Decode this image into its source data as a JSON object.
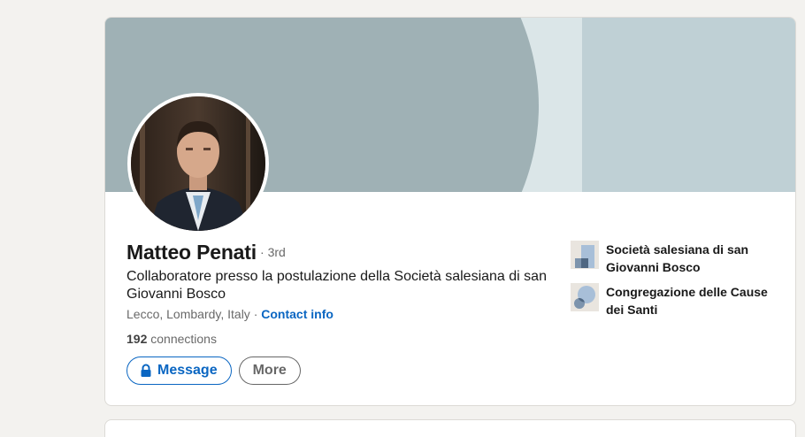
{
  "profile": {
    "name": "Matteo Penati",
    "degree": "3rd",
    "degree_separator": "·",
    "headline": "Collaboratore presso la postulazione della Società salesiana di san Giovanni Bosco",
    "location": "Lecco, Lombardy, Italy",
    "location_separator": " · ",
    "contact_info_label": "Contact info",
    "connections_count": "192",
    "connections_label": "connections"
  },
  "actions": {
    "message_label": "Message",
    "more_label": "More"
  },
  "organizations": [
    {
      "name": "Società salesiana di san Giovanni Bosco",
      "icon": "company-logo-icon"
    },
    {
      "name": "Congregazione delle Cause dei Santi",
      "icon": "school-logo-icon"
    }
  ],
  "colors": {
    "accent": "#0a66c2",
    "banner_light": "#bfd0d5",
    "banner_dark": "#9fb1b5",
    "page_bg": "#f3f2ef"
  }
}
